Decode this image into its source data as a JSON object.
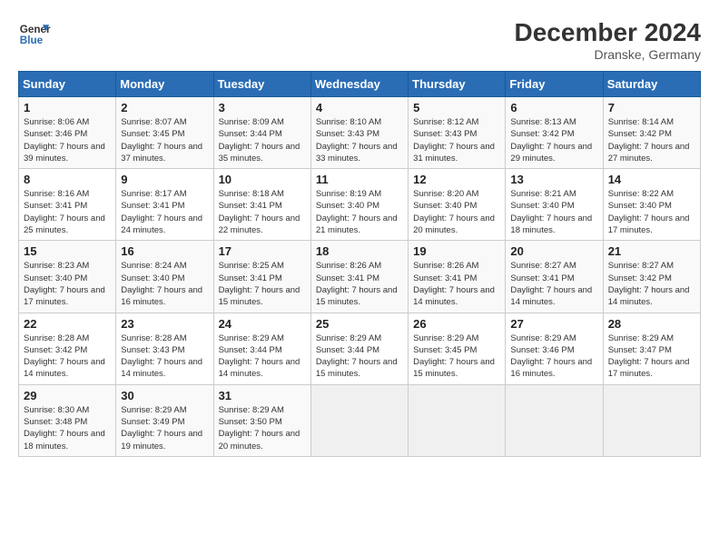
{
  "header": {
    "logo_line1": "General",
    "logo_line2": "Blue",
    "month": "December 2024",
    "location": "Dranske, Germany"
  },
  "days_of_week": [
    "Sunday",
    "Monday",
    "Tuesday",
    "Wednesday",
    "Thursday",
    "Friday",
    "Saturday"
  ],
  "weeks": [
    [
      {
        "day": "1",
        "sunrise": "Sunrise: 8:06 AM",
        "sunset": "Sunset: 3:46 PM",
        "daylight": "Daylight: 7 hours and 39 minutes."
      },
      {
        "day": "2",
        "sunrise": "Sunrise: 8:07 AM",
        "sunset": "Sunset: 3:45 PM",
        "daylight": "Daylight: 7 hours and 37 minutes."
      },
      {
        "day": "3",
        "sunrise": "Sunrise: 8:09 AM",
        "sunset": "Sunset: 3:44 PM",
        "daylight": "Daylight: 7 hours and 35 minutes."
      },
      {
        "day": "4",
        "sunrise": "Sunrise: 8:10 AM",
        "sunset": "Sunset: 3:43 PM",
        "daylight": "Daylight: 7 hours and 33 minutes."
      },
      {
        "day": "5",
        "sunrise": "Sunrise: 8:12 AM",
        "sunset": "Sunset: 3:43 PM",
        "daylight": "Daylight: 7 hours and 31 minutes."
      },
      {
        "day": "6",
        "sunrise": "Sunrise: 8:13 AM",
        "sunset": "Sunset: 3:42 PM",
        "daylight": "Daylight: 7 hours and 29 minutes."
      },
      {
        "day": "7",
        "sunrise": "Sunrise: 8:14 AM",
        "sunset": "Sunset: 3:42 PM",
        "daylight": "Daylight: 7 hours and 27 minutes."
      }
    ],
    [
      {
        "day": "8",
        "sunrise": "Sunrise: 8:16 AM",
        "sunset": "Sunset: 3:41 PM",
        "daylight": "Daylight: 7 hours and 25 minutes."
      },
      {
        "day": "9",
        "sunrise": "Sunrise: 8:17 AM",
        "sunset": "Sunset: 3:41 PM",
        "daylight": "Daylight: 7 hours and 24 minutes."
      },
      {
        "day": "10",
        "sunrise": "Sunrise: 8:18 AM",
        "sunset": "Sunset: 3:41 PM",
        "daylight": "Daylight: 7 hours and 22 minutes."
      },
      {
        "day": "11",
        "sunrise": "Sunrise: 8:19 AM",
        "sunset": "Sunset: 3:40 PM",
        "daylight": "Daylight: 7 hours and 21 minutes."
      },
      {
        "day": "12",
        "sunrise": "Sunrise: 8:20 AM",
        "sunset": "Sunset: 3:40 PM",
        "daylight": "Daylight: 7 hours and 20 minutes."
      },
      {
        "day": "13",
        "sunrise": "Sunrise: 8:21 AM",
        "sunset": "Sunset: 3:40 PM",
        "daylight": "Daylight: 7 hours and 18 minutes."
      },
      {
        "day": "14",
        "sunrise": "Sunrise: 8:22 AM",
        "sunset": "Sunset: 3:40 PM",
        "daylight": "Daylight: 7 hours and 17 minutes."
      }
    ],
    [
      {
        "day": "15",
        "sunrise": "Sunrise: 8:23 AM",
        "sunset": "Sunset: 3:40 PM",
        "daylight": "Daylight: 7 hours and 17 minutes."
      },
      {
        "day": "16",
        "sunrise": "Sunrise: 8:24 AM",
        "sunset": "Sunset: 3:40 PM",
        "daylight": "Daylight: 7 hours and 16 minutes."
      },
      {
        "day": "17",
        "sunrise": "Sunrise: 8:25 AM",
        "sunset": "Sunset: 3:41 PM",
        "daylight": "Daylight: 7 hours and 15 minutes."
      },
      {
        "day": "18",
        "sunrise": "Sunrise: 8:26 AM",
        "sunset": "Sunset: 3:41 PM",
        "daylight": "Daylight: 7 hours and 15 minutes."
      },
      {
        "day": "19",
        "sunrise": "Sunrise: 8:26 AM",
        "sunset": "Sunset: 3:41 PM",
        "daylight": "Daylight: 7 hours and 14 minutes."
      },
      {
        "day": "20",
        "sunrise": "Sunrise: 8:27 AM",
        "sunset": "Sunset: 3:41 PM",
        "daylight": "Daylight: 7 hours and 14 minutes."
      },
      {
        "day": "21",
        "sunrise": "Sunrise: 8:27 AM",
        "sunset": "Sunset: 3:42 PM",
        "daylight": "Daylight: 7 hours and 14 minutes."
      }
    ],
    [
      {
        "day": "22",
        "sunrise": "Sunrise: 8:28 AM",
        "sunset": "Sunset: 3:42 PM",
        "daylight": "Daylight: 7 hours and 14 minutes."
      },
      {
        "day": "23",
        "sunrise": "Sunrise: 8:28 AM",
        "sunset": "Sunset: 3:43 PM",
        "daylight": "Daylight: 7 hours and 14 minutes."
      },
      {
        "day": "24",
        "sunrise": "Sunrise: 8:29 AM",
        "sunset": "Sunset: 3:44 PM",
        "daylight": "Daylight: 7 hours and 14 minutes."
      },
      {
        "day": "25",
        "sunrise": "Sunrise: 8:29 AM",
        "sunset": "Sunset: 3:44 PM",
        "daylight": "Daylight: 7 hours and 15 minutes."
      },
      {
        "day": "26",
        "sunrise": "Sunrise: 8:29 AM",
        "sunset": "Sunset: 3:45 PM",
        "daylight": "Daylight: 7 hours and 15 minutes."
      },
      {
        "day": "27",
        "sunrise": "Sunrise: 8:29 AM",
        "sunset": "Sunset: 3:46 PM",
        "daylight": "Daylight: 7 hours and 16 minutes."
      },
      {
        "day": "28",
        "sunrise": "Sunrise: 8:29 AM",
        "sunset": "Sunset: 3:47 PM",
        "daylight": "Daylight: 7 hours and 17 minutes."
      }
    ],
    [
      {
        "day": "29",
        "sunrise": "Sunrise: 8:30 AM",
        "sunset": "Sunset: 3:48 PM",
        "daylight": "Daylight: 7 hours and 18 minutes."
      },
      {
        "day": "30",
        "sunrise": "Sunrise: 8:29 AM",
        "sunset": "Sunset: 3:49 PM",
        "daylight": "Daylight: 7 hours and 19 minutes."
      },
      {
        "day": "31",
        "sunrise": "Sunrise: 8:29 AM",
        "sunset": "Sunset: 3:50 PM",
        "daylight": "Daylight: 7 hours and 20 minutes."
      },
      null,
      null,
      null,
      null
    ]
  ]
}
